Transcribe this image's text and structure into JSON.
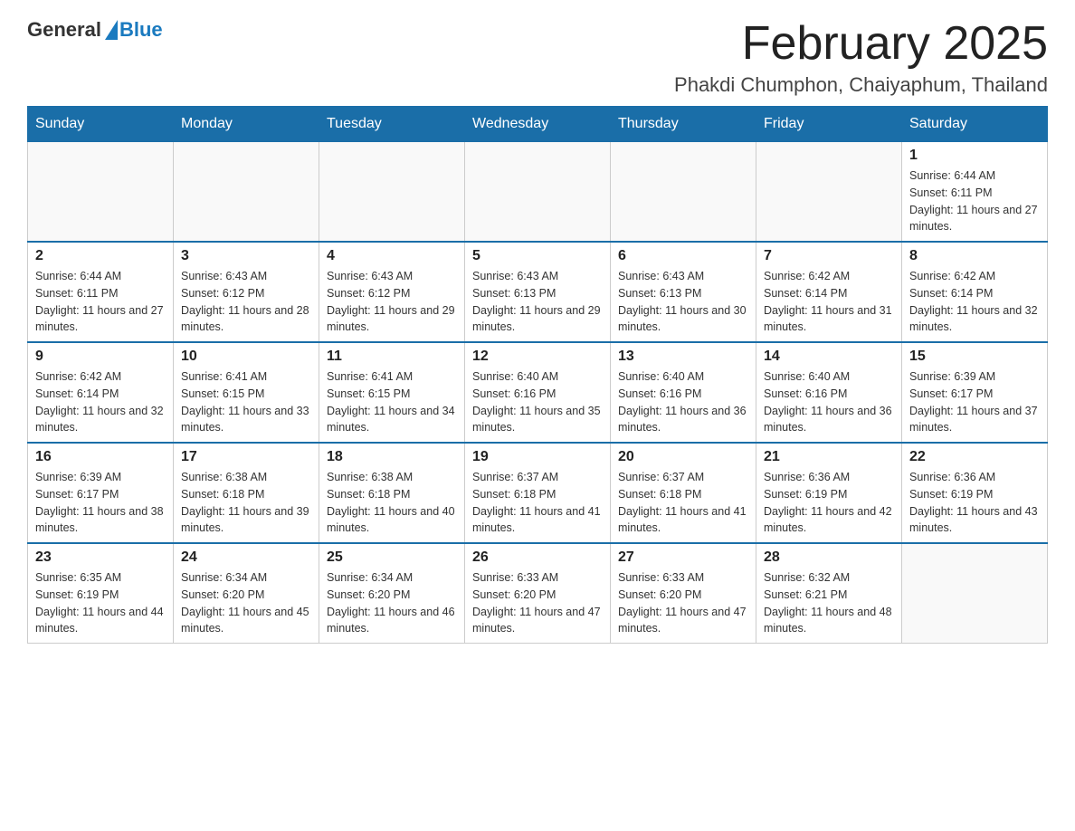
{
  "logo": {
    "general": "General",
    "blue": "Blue"
  },
  "title": "February 2025",
  "subtitle": "Phakdi Chumphon, Chaiyaphum, Thailand",
  "days_of_week": [
    "Sunday",
    "Monday",
    "Tuesday",
    "Wednesday",
    "Thursday",
    "Friday",
    "Saturday"
  ],
  "weeks": [
    [
      {
        "day": "",
        "sunrise": "",
        "sunset": "",
        "daylight": ""
      },
      {
        "day": "",
        "sunrise": "",
        "sunset": "",
        "daylight": ""
      },
      {
        "day": "",
        "sunrise": "",
        "sunset": "",
        "daylight": ""
      },
      {
        "day": "",
        "sunrise": "",
        "sunset": "",
        "daylight": ""
      },
      {
        "day": "",
        "sunrise": "",
        "sunset": "",
        "daylight": ""
      },
      {
        "day": "",
        "sunrise": "",
        "sunset": "",
        "daylight": ""
      },
      {
        "day": "1",
        "sunrise": "Sunrise: 6:44 AM",
        "sunset": "Sunset: 6:11 PM",
        "daylight": "Daylight: 11 hours and 27 minutes."
      }
    ],
    [
      {
        "day": "2",
        "sunrise": "Sunrise: 6:44 AM",
        "sunset": "Sunset: 6:11 PM",
        "daylight": "Daylight: 11 hours and 27 minutes."
      },
      {
        "day": "3",
        "sunrise": "Sunrise: 6:43 AM",
        "sunset": "Sunset: 6:12 PM",
        "daylight": "Daylight: 11 hours and 28 minutes."
      },
      {
        "day": "4",
        "sunrise": "Sunrise: 6:43 AM",
        "sunset": "Sunset: 6:12 PM",
        "daylight": "Daylight: 11 hours and 29 minutes."
      },
      {
        "day": "5",
        "sunrise": "Sunrise: 6:43 AM",
        "sunset": "Sunset: 6:13 PM",
        "daylight": "Daylight: 11 hours and 29 minutes."
      },
      {
        "day": "6",
        "sunrise": "Sunrise: 6:43 AM",
        "sunset": "Sunset: 6:13 PM",
        "daylight": "Daylight: 11 hours and 30 minutes."
      },
      {
        "day": "7",
        "sunrise": "Sunrise: 6:42 AM",
        "sunset": "Sunset: 6:14 PM",
        "daylight": "Daylight: 11 hours and 31 minutes."
      },
      {
        "day": "8",
        "sunrise": "Sunrise: 6:42 AM",
        "sunset": "Sunset: 6:14 PM",
        "daylight": "Daylight: 11 hours and 32 minutes."
      }
    ],
    [
      {
        "day": "9",
        "sunrise": "Sunrise: 6:42 AM",
        "sunset": "Sunset: 6:14 PM",
        "daylight": "Daylight: 11 hours and 32 minutes."
      },
      {
        "day": "10",
        "sunrise": "Sunrise: 6:41 AM",
        "sunset": "Sunset: 6:15 PM",
        "daylight": "Daylight: 11 hours and 33 minutes."
      },
      {
        "day": "11",
        "sunrise": "Sunrise: 6:41 AM",
        "sunset": "Sunset: 6:15 PM",
        "daylight": "Daylight: 11 hours and 34 minutes."
      },
      {
        "day": "12",
        "sunrise": "Sunrise: 6:40 AM",
        "sunset": "Sunset: 6:16 PM",
        "daylight": "Daylight: 11 hours and 35 minutes."
      },
      {
        "day": "13",
        "sunrise": "Sunrise: 6:40 AM",
        "sunset": "Sunset: 6:16 PM",
        "daylight": "Daylight: 11 hours and 36 minutes."
      },
      {
        "day": "14",
        "sunrise": "Sunrise: 6:40 AM",
        "sunset": "Sunset: 6:16 PM",
        "daylight": "Daylight: 11 hours and 36 minutes."
      },
      {
        "day": "15",
        "sunrise": "Sunrise: 6:39 AM",
        "sunset": "Sunset: 6:17 PM",
        "daylight": "Daylight: 11 hours and 37 minutes."
      }
    ],
    [
      {
        "day": "16",
        "sunrise": "Sunrise: 6:39 AM",
        "sunset": "Sunset: 6:17 PM",
        "daylight": "Daylight: 11 hours and 38 minutes."
      },
      {
        "day": "17",
        "sunrise": "Sunrise: 6:38 AM",
        "sunset": "Sunset: 6:18 PM",
        "daylight": "Daylight: 11 hours and 39 minutes."
      },
      {
        "day": "18",
        "sunrise": "Sunrise: 6:38 AM",
        "sunset": "Sunset: 6:18 PM",
        "daylight": "Daylight: 11 hours and 40 minutes."
      },
      {
        "day": "19",
        "sunrise": "Sunrise: 6:37 AM",
        "sunset": "Sunset: 6:18 PM",
        "daylight": "Daylight: 11 hours and 41 minutes."
      },
      {
        "day": "20",
        "sunrise": "Sunrise: 6:37 AM",
        "sunset": "Sunset: 6:18 PM",
        "daylight": "Daylight: 11 hours and 41 minutes."
      },
      {
        "day": "21",
        "sunrise": "Sunrise: 6:36 AM",
        "sunset": "Sunset: 6:19 PM",
        "daylight": "Daylight: 11 hours and 42 minutes."
      },
      {
        "day": "22",
        "sunrise": "Sunrise: 6:36 AM",
        "sunset": "Sunset: 6:19 PM",
        "daylight": "Daylight: 11 hours and 43 minutes."
      }
    ],
    [
      {
        "day": "23",
        "sunrise": "Sunrise: 6:35 AM",
        "sunset": "Sunset: 6:19 PM",
        "daylight": "Daylight: 11 hours and 44 minutes."
      },
      {
        "day": "24",
        "sunrise": "Sunrise: 6:34 AM",
        "sunset": "Sunset: 6:20 PM",
        "daylight": "Daylight: 11 hours and 45 minutes."
      },
      {
        "day": "25",
        "sunrise": "Sunrise: 6:34 AM",
        "sunset": "Sunset: 6:20 PM",
        "daylight": "Daylight: 11 hours and 46 minutes."
      },
      {
        "day": "26",
        "sunrise": "Sunrise: 6:33 AM",
        "sunset": "Sunset: 6:20 PM",
        "daylight": "Daylight: 11 hours and 47 minutes."
      },
      {
        "day": "27",
        "sunrise": "Sunrise: 6:33 AM",
        "sunset": "Sunset: 6:20 PM",
        "daylight": "Daylight: 11 hours and 47 minutes."
      },
      {
        "day": "28",
        "sunrise": "Sunrise: 6:32 AM",
        "sunset": "Sunset: 6:21 PM",
        "daylight": "Daylight: 11 hours and 48 minutes."
      },
      {
        "day": "",
        "sunrise": "",
        "sunset": "",
        "daylight": ""
      }
    ]
  ]
}
